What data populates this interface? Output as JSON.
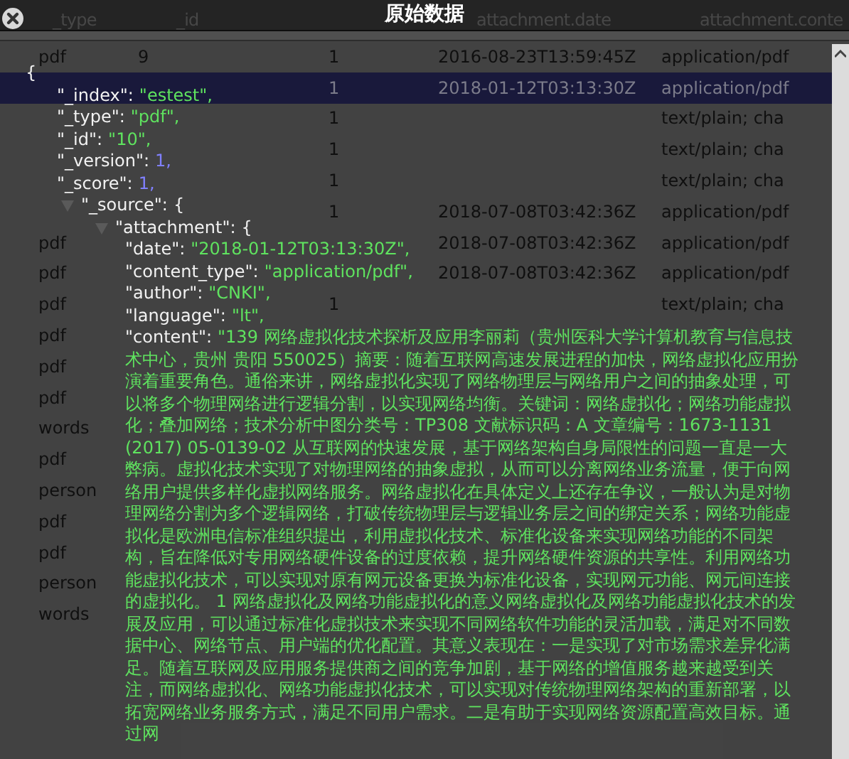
{
  "title": "原始数据",
  "table": {
    "columns": [
      {
        "label": "_type"
      },
      {
        "label": "_id"
      },
      {},
      {
        "label": "attachment.date"
      },
      {
        "label": "attachment.conte"
      }
    ],
    "rows": [
      {
        "selected": false,
        "cells": [
          "pdf",
          "9",
          "1",
          "2016-08-23T13:59:45Z",
          "application/pdf"
        ]
      },
      {
        "selected": true,
        "cells": [
          null,
          null,
          "1",
          "2018-01-12T03:13:30Z",
          "application/pdf"
        ]
      },
      {
        "selected": false,
        "cells": [
          null,
          null,
          "1",
          null,
          "text/plain; cha"
        ]
      },
      {
        "selected": false,
        "cells": [
          null,
          null,
          "1",
          null,
          "text/plain; cha"
        ]
      },
      {
        "selected": false,
        "cells": [
          null,
          null,
          "1",
          null,
          "text/plain; cha"
        ]
      },
      {
        "selected": false,
        "cells": [
          null,
          null,
          "1",
          "2018-07-08T03:42:36Z",
          "application/pdf"
        ]
      },
      {
        "selected": false,
        "cells": [
          "pdf",
          null,
          null,
          "2018-07-08T03:42:36Z",
          "application/pdf"
        ]
      },
      {
        "selected": false,
        "cells": [
          "pdf",
          null,
          null,
          "2018-07-08T03:42:36Z",
          "application/pdf"
        ]
      },
      {
        "selected": false,
        "cells": [
          "pdf",
          null,
          "1",
          null,
          "text/plain; cha"
        ]
      },
      {
        "selected": false,
        "cells": [
          "pdf",
          null,
          null,
          null,
          null
        ]
      },
      {
        "selected": false,
        "cells": [
          "pdf",
          null,
          null,
          null,
          null
        ]
      },
      {
        "selected": false,
        "cells": [
          "pdf",
          null,
          null,
          null,
          null
        ]
      },
      {
        "selected": false,
        "cells": [
          "words",
          null,
          null,
          null,
          null
        ]
      },
      {
        "selected": false,
        "cells": [
          "pdf",
          null,
          null,
          null,
          null
        ]
      },
      {
        "selected": false,
        "cells": [
          "person",
          null,
          null,
          null,
          null
        ]
      },
      {
        "selected": false,
        "cells": [
          "pdf",
          null,
          null,
          null,
          null
        ]
      },
      {
        "selected": false,
        "cells": [
          "pdf",
          null,
          null,
          null,
          null
        ]
      },
      {
        "selected": false,
        "cells": [
          "person",
          null,
          null,
          null,
          null
        ]
      },
      {
        "selected": false,
        "cells": [
          "words",
          null,
          null,
          null,
          null
        ]
      }
    ]
  },
  "document": {
    "open": "{",
    "entries": [
      {
        "kind": "string",
        "key": "\"_index\":",
        "value": "\"estest\","
      },
      {
        "kind": "string",
        "key": "\"_type\":",
        "value": "\"pdf\","
      },
      {
        "kind": "string",
        "key": "\"_id\":",
        "value": "\"10\","
      },
      {
        "kind": "number",
        "key": "\"_version\":",
        "value": "1,"
      },
      {
        "kind": "number",
        "key": "\"_score\":",
        "value": "1,"
      },
      {
        "kind": "object",
        "key": "\"_source\":",
        "value": "{",
        "expanded": true,
        "children": [
          {
            "kind": "object",
            "key": "\"attachment\":",
            "value": "{",
            "expanded": true,
            "children": [
              {
                "kind": "string",
                "key": "\"date\":",
                "value": "\"2018-01-12T03:13:30Z\","
              },
              {
                "kind": "string",
                "key": "\"content_type\":",
                "value": "\"application/pdf\","
              },
              {
                "kind": "string",
                "key": "\"author\":",
                "value": "\"CNKI\","
              },
              {
                "kind": "string",
                "key": "\"language\":",
                "value": "\"lt\","
              },
              {
                "kind": "string",
                "key": "\"content\":",
                "value": "\"139 网络虚拟化技术探析及应用李丽莉（贵州医科大学计算机教育与信息技术中心，贵州 贵阳 550025）摘要：随着互联网高速发展进程的加快，网络虚拟化应用扮演着重要角色。通俗来讲，网络虚拟化实现了网络物理层与网络用户之间的抽象处理，可以将多个物理网络进行逻辑分割，以实现网络均衡。关键词：网络虚拟化；网络功能虚拟化；叠加网络；技术分析中图分类号：TP308 文献标识码：A 文章编号：1673-1131 (2017) 05-0139-02 从互联网的快速发展，基于网络架构自身局限性的问题一直是一大弊病。虚拟化技术实现了对物理网络的抽象虚拟，从而可以分离网络业务流量，便于向网络用户提供多样化虚拟网络服务。网络虚拟化在具体定义上还存在争议，一般认为是对物理网络分割为多个逻辑网络，打破传统物理层与逻辑业务层之间的绑定关系；网络功能虚拟化是欧洲电信标准组织提出，利用虚拟化技术、标准化设备来实现网络功能的不同架构，旨在降低对专用网络硬件设备的过度依赖，提升网络硬件资源的共享性。利用网络功能虚拟化技术，可以实现对原有网元设备更换为标准化设备，实现网元功能、网元间连接的虚拟化。 1 网络虚拟化及网络功能虚拟化的意义网络虚拟化及网络功能虚拟化技术的发展及应用，可以通过标准化虚拟技术来实现不同网络软件功能的灵活加载，满足对不同数据中心、网络节点、用户端的优化配置。其意义表现在：一是实现了对市场需求差异化满足。随着互联网及应用服务提供商之间的竞争加剧，基于网络的增值服务越来越受到关注，而网络虚拟化、网络功能虚拟化技术，可以实现对传统物理网络架构的重新部署，以拓宽网络业务服务方式，满足不同用户需求。二是有助于实现网络资源配置高效目标。通过网"
              }
            ]
          }
        ]
      }
    ]
  }
}
